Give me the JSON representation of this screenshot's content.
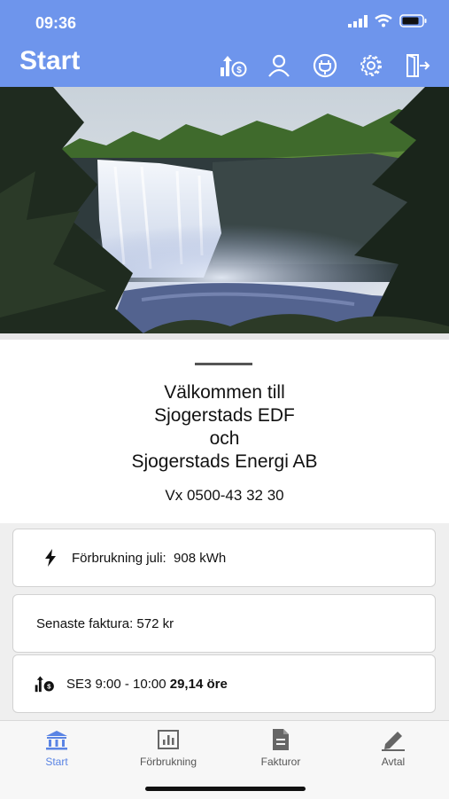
{
  "status": {
    "time": "09:36"
  },
  "header": {
    "title": "Start"
  },
  "toolbar": {
    "icons": [
      "price-icon",
      "user-icon",
      "plug-icon",
      "settings-icon",
      "logout-icon"
    ]
  },
  "welcome": {
    "lines": [
      "Välkommen till",
      "Sjogerstads EDF",
      "och",
      "Sjogerstads Energi AB"
    ],
    "phone": "Vx 0500-43 32 30"
  },
  "cards": {
    "consumption": {
      "label": "Förbrukning juli:  908 kWh"
    },
    "invoice": {
      "label": "Senaste faktura: 572 kr"
    },
    "price": {
      "label": "SE3 9:00 - 10:00 ",
      "value": "29,14 öre"
    }
  },
  "tabs": [
    {
      "label": "Start"
    },
    {
      "label": "Förbrukning"
    },
    {
      "label": "Fakturor"
    },
    {
      "label": "Avtal"
    }
  ],
  "colors": {
    "accent": "#6e95ec",
    "tab_active": "#5a84e4"
  }
}
